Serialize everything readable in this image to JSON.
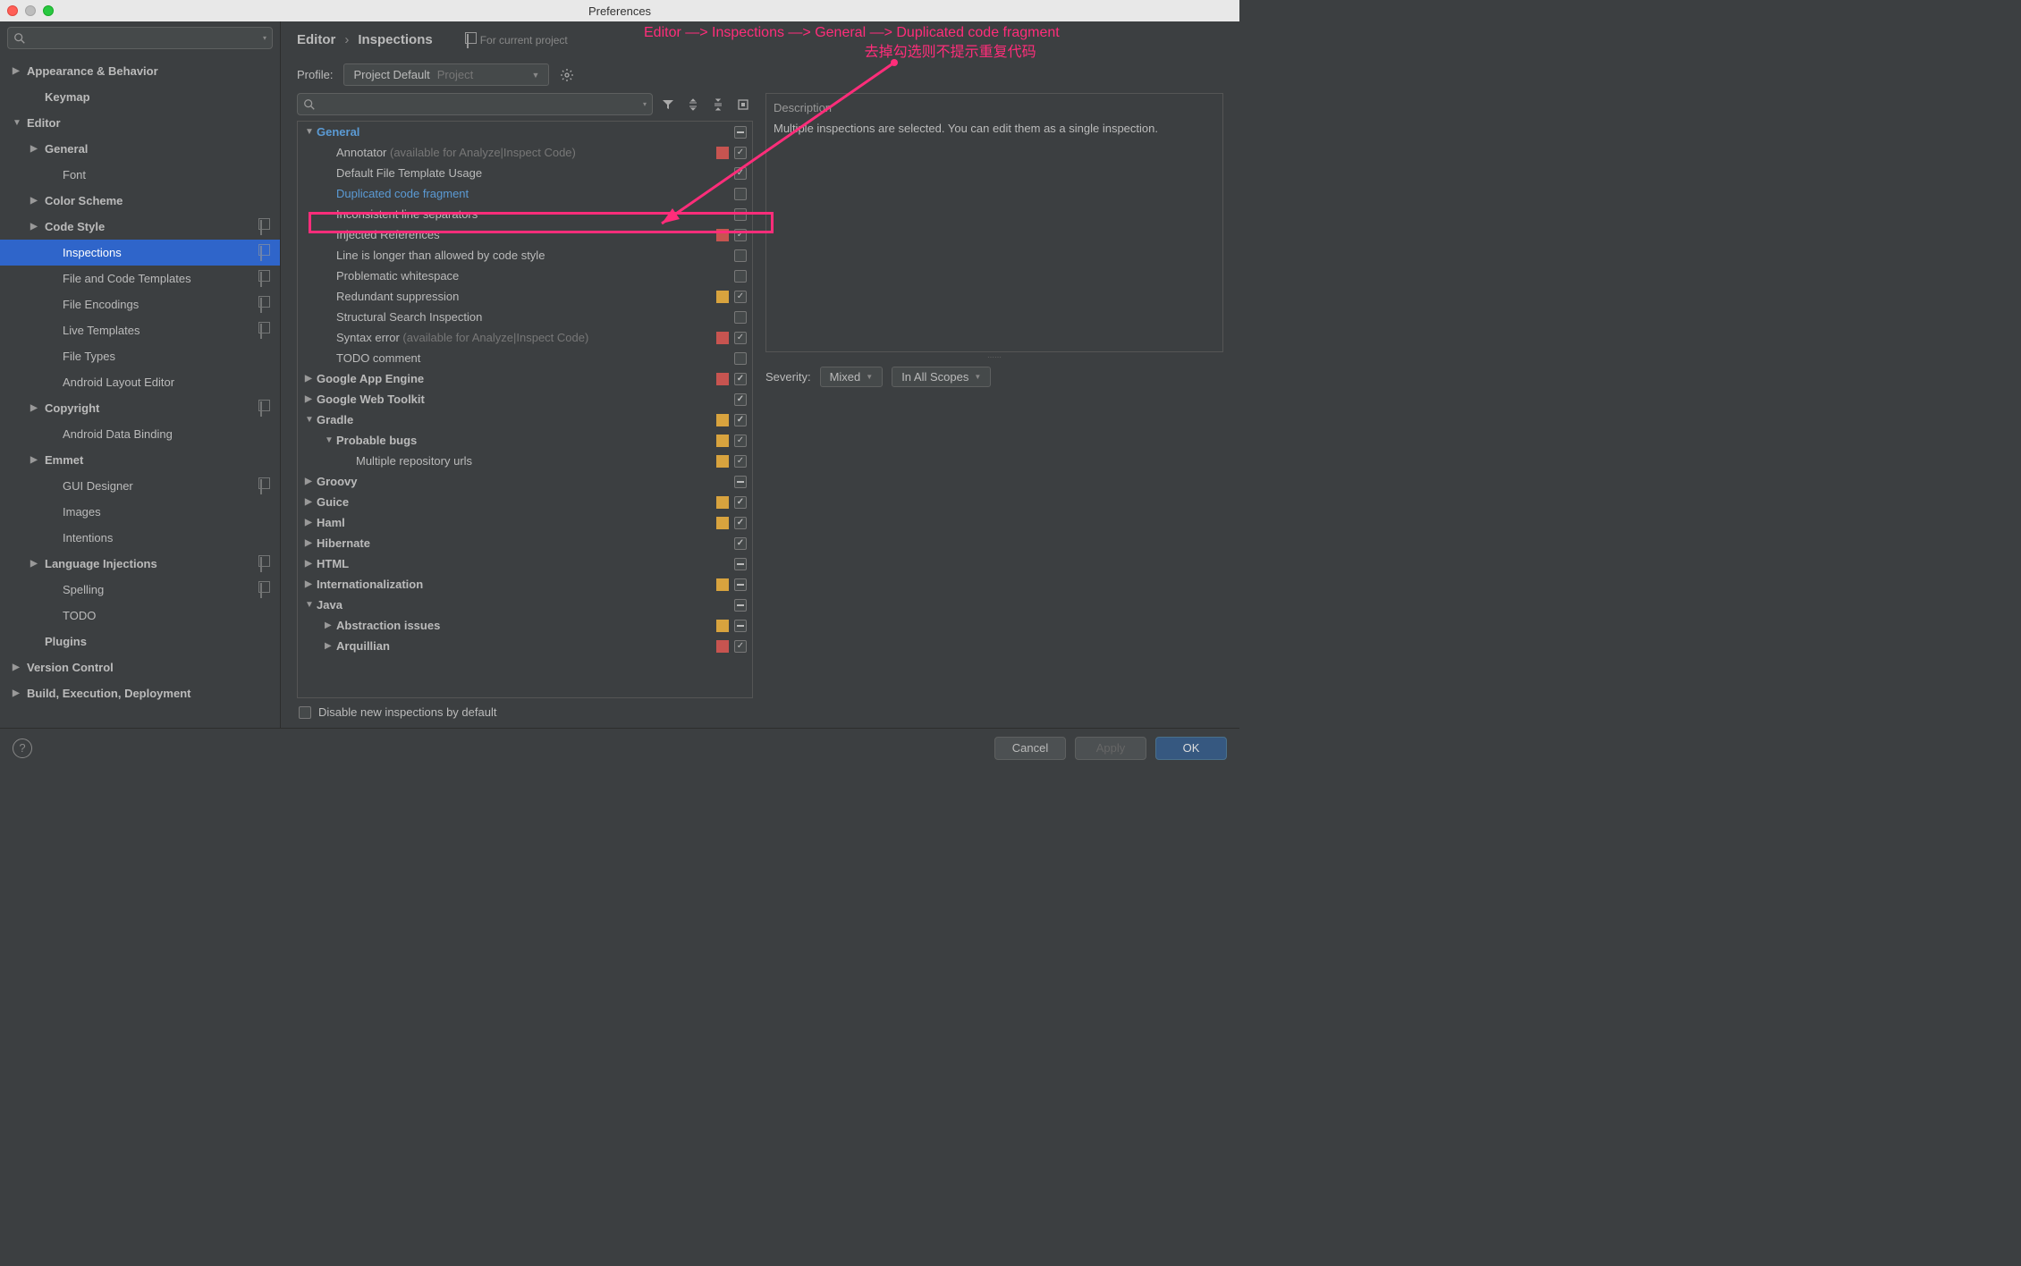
{
  "window_title": "Preferences",
  "annotation": {
    "line1": "Editor —> Inspections —> General —> Duplicated code fragment",
    "line2": "去掉勾选则不提示重复代码"
  },
  "sidebar": {
    "search_placeholder": "",
    "tree": [
      {
        "label": "Appearance & Behavior",
        "level": 0,
        "arrow": "▶",
        "bold": true
      },
      {
        "label": "Keymap",
        "level": 1,
        "bold": true
      },
      {
        "label": "Editor",
        "level": 0,
        "arrow": "▼",
        "bold": true
      },
      {
        "label": "General",
        "level": 1,
        "arrow": "▶",
        "copy": false
      },
      {
        "label": "Font",
        "level": 2
      },
      {
        "label": "Color Scheme",
        "level": 1,
        "arrow": "▶"
      },
      {
        "label": "Code Style",
        "level": 1,
        "arrow": "▶",
        "copy": true
      },
      {
        "label": "Inspections",
        "level": 2,
        "selected": true,
        "copy": true
      },
      {
        "label": "File and Code Templates",
        "level": 2,
        "copy": true
      },
      {
        "label": "File Encodings",
        "level": 2,
        "copy": true
      },
      {
        "label": "Live Templates",
        "level": 2,
        "copy": true
      },
      {
        "label": "File Types",
        "level": 2
      },
      {
        "label": "Android Layout Editor",
        "level": 2
      },
      {
        "label": "Copyright",
        "level": 1,
        "arrow": "▶",
        "copy": true
      },
      {
        "label": "Android Data Binding",
        "level": 2
      },
      {
        "label": "Emmet",
        "level": 1,
        "arrow": "▶"
      },
      {
        "label": "GUI Designer",
        "level": 2,
        "copy": true
      },
      {
        "label": "Images",
        "level": 2
      },
      {
        "label": "Intentions",
        "level": 2
      },
      {
        "label": "Language Injections",
        "level": 1,
        "arrow": "▶",
        "copy": true
      },
      {
        "label": "Spelling",
        "level": 2,
        "copy": true
      },
      {
        "label": "TODO",
        "level": 2
      },
      {
        "label": "Plugins",
        "level": 1,
        "bold": true
      },
      {
        "label": "Version Control",
        "level": 0,
        "arrow": "▶",
        "bold": true
      },
      {
        "label": "Build, Execution, Deployment",
        "level": 0,
        "arrow": "▶",
        "bold": true
      }
    ]
  },
  "header": {
    "breadcrumb": [
      "Editor",
      "Inspections"
    ],
    "for_current_project": "For current project",
    "profile_label": "Profile:",
    "profile_name": "Project Default",
    "profile_badge": "Project"
  },
  "inspections": [
    {
      "label": "General",
      "depth": 0,
      "arrow": "▼",
      "hl": true,
      "cb": "ind"
    },
    {
      "label": "Annotator",
      "hint": " (available for Analyze|Inspect Code)",
      "depth": 1,
      "sev": "red",
      "cb": "chk"
    },
    {
      "label": "Default File Template Usage",
      "depth": 1,
      "cb": "chk"
    },
    {
      "label": "Duplicated code fragment",
      "depth": 1,
      "hl": true,
      "cb": "off"
    },
    {
      "label": "Inconsistent line separators",
      "depth": 1,
      "cb": "off"
    },
    {
      "label": "Injected References",
      "depth": 1,
      "sev": "red",
      "cb": "chk"
    },
    {
      "label": "Line is longer than allowed by code style",
      "depth": 1,
      "cb": "off"
    },
    {
      "label": "Problematic whitespace",
      "depth": 1,
      "cb": "off"
    },
    {
      "label": "Redundant suppression",
      "depth": 1,
      "sev": "yellow",
      "cb": "chk"
    },
    {
      "label": "Structural Search Inspection",
      "depth": 1,
      "cb": "off"
    },
    {
      "label": "Syntax error",
      "hint": " (available for Analyze|Inspect Code)",
      "depth": 1,
      "sev": "red",
      "cb": "chk"
    },
    {
      "label": "TODO comment",
      "depth": 1,
      "cb": "off"
    },
    {
      "label": "Google App Engine",
      "depth": 0,
      "arrow": "▶",
      "sev": "red",
      "cb": "chk"
    },
    {
      "label": "Google Web Toolkit",
      "depth": 0,
      "arrow": "▶",
      "cb": "chk"
    },
    {
      "label": "Gradle",
      "depth": 0,
      "arrow": "▼",
      "sev": "yellow",
      "cb": "chk"
    },
    {
      "label": "Probable bugs",
      "depth": 1,
      "arrow": "▼",
      "bold": true,
      "sev": "yellow",
      "cb": "chk"
    },
    {
      "label": "Multiple repository urls",
      "depth": 2,
      "sev": "yellow",
      "cb": "chk"
    },
    {
      "label": "Groovy",
      "depth": 0,
      "arrow": "▶",
      "cb": "ind"
    },
    {
      "label": "Guice",
      "depth": 0,
      "arrow": "▶",
      "sev": "yellow",
      "cb": "chk"
    },
    {
      "label": "Haml",
      "depth": 0,
      "arrow": "▶",
      "sev": "yellow",
      "cb": "chk"
    },
    {
      "label": "Hibernate",
      "depth": 0,
      "arrow": "▶",
      "cb": "chk"
    },
    {
      "label": "HTML",
      "depth": 0,
      "arrow": "▶",
      "cb": "ind"
    },
    {
      "label": "Internationalization",
      "depth": 0,
      "arrow": "▶",
      "sev": "yellow",
      "cb": "ind"
    },
    {
      "label": "Java",
      "depth": 0,
      "arrow": "▼",
      "cb": "ind"
    },
    {
      "label": "Abstraction issues",
      "depth": 1,
      "arrow": "▶",
      "bold": true,
      "sev": "yellow",
      "cb": "ind"
    },
    {
      "label": "Arquillian",
      "depth": 1,
      "arrow": "▶",
      "bold": true,
      "sev": "red",
      "cb": "chk"
    }
  ],
  "disable_label": "Disable new inspections by default",
  "right": {
    "desc_title": "Description",
    "desc_body": "Multiple inspections are selected. You can edit them as a single inspection.",
    "severity_label": "Severity:",
    "severity_value": "Mixed",
    "scope_value": "In All Scopes"
  },
  "footer": {
    "cancel": "Cancel",
    "apply": "Apply",
    "ok": "OK"
  }
}
